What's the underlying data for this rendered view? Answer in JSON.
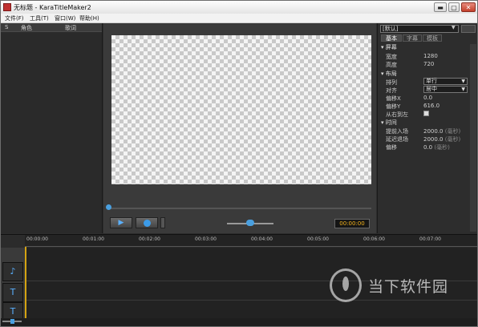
{
  "window": {
    "title": "无标题 - KaraTitleMaker2",
    "buttons": {
      "minimize": "▬",
      "maximize": "▢",
      "close": "✕"
    }
  },
  "menu": [
    "文件(F)",
    "工具(T)",
    "窗口(W)",
    "帮助(H)"
  ],
  "left_panel": {
    "columns": [
      "S",
      "角色",
      "歌词"
    ]
  },
  "player": {
    "play_icon": "▶",
    "timecode": "00:00:00"
  },
  "right_panel": {
    "preset": "[默认]",
    "tabs": [
      "基本",
      "字幕",
      "模板"
    ],
    "sections": {
      "screen": {
        "title": "屏幕",
        "width_label": "宽度",
        "width_value": "1280",
        "height_label": "高度",
        "height_value": "720"
      },
      "layout": {
        "title": "布局",
        "arrange_label": "排列",
        "arrange_value": "单行",
        "align_label": "对齐",
        "align_value": "居中",
        "offset_x_label": "偏移X",
        "offset_x_value": "0.0",
        "offset_y_label": "偏移Y",
        "offset_y_value": "616.0",
        "rtl_label": "从右到左"
      },
      "timing": {
        "title": "时间",
        "fade_in_label": "提前入场",
        "fade_in_value": "2000.0",
        "fade_out_label": "延迟退场",
        "fade_out_value": "2000.0",
        "offset_label": "偏移",
        "offset_value": "0.0",
        "unit": "(毫秒)"
      }
    }
  },
  "timeline": {
    "ticks": [
      "00:00:00",
      "00:01:00",
      "00:02:00",
      "00:03:00",
      "00:04:00",
      "00:05:00",
      "00:06:00",
      "00:07:00"
    ]
  },
  "watermark": {
    "text": "当下软件园"
  },
  "colors": {
    "accent": "#4aa0e0",
    "timecode": "#f3b21b"
  }
}
